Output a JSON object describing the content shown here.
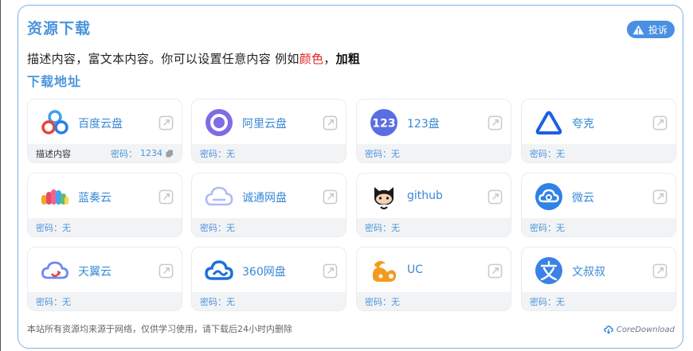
{
  "header": {
    "title": "资源下载",
    "report_label": "投诉"
  },
  "description": {
    "prefix": "描述内容，富文本内容。你可以设置任意内容 例如",
    "red_text": "颜色",
    "separator": "，",
    "bold_text": "加粗"
  },
  "downloads": {
    "title": "下载地址",
    "password_label": "密码：",
    "items": [
      {
        "name": "百度云盘",
        "icon": "baidu-cloud-icon",
        "note": "描述内容",
        "password": "1234"
      },
      {
        "name": "阿里云盘",
        "icon": "aliyun-drive-icon",
        "note": "",
        "password": "无"
      },
      {
        "name": "123盘",
        "icon": "pan123-icon",
        "note": "",
        "password": "无"
      },
      {
        "name": "夸克",
        "icon": "quark-icon",
        "note": "",
        "password": "无"
      },
      {
        "name": "蓝奏云",
        "icon": "lanzou-icon",
        "note": "",
        "password": "无"
      },
      {
        "name": "诚通网盘",
        "icon": "ctfile-icon",
        "note": "",
        "password": "无"
      },
      {
        "name": "github",
        "icon": "github-icon",
        "note": "",
        "password": "无"
      },
      {
        "name": "微云",
        "icon": "weiyun-icon",
        "note": "",
        "password": "无"
      },
      {
        "name": "天翼云",
        "icon": "tianyi-cloud-icon",
        "note": "",
        "password": "无"
      },
      {
        "name": "360网盘",
        "icon": "pan360-icon",
        "note": "",
        "password": "无"
      },
      {
        "name": "UC",
        "icon": "uc-icon",
        "note": "",
        "password": "无"
      },
      {
        "name": "文叔叔",
        "icon": "wenshushu-icon",
        "note": "",
        "password": "无"
      }
    ]
  },
  "footer": {
    "notice": "本站所有资源均来源于网络，仅供学习使用，请下载后24小时内删除",
    "brand": "CoreDownload"
  },
  "colors": {
    "accent": "#4b95dc",
    "badge": "#4a90e2",
    "highlight": "#e02020"
  }
}
